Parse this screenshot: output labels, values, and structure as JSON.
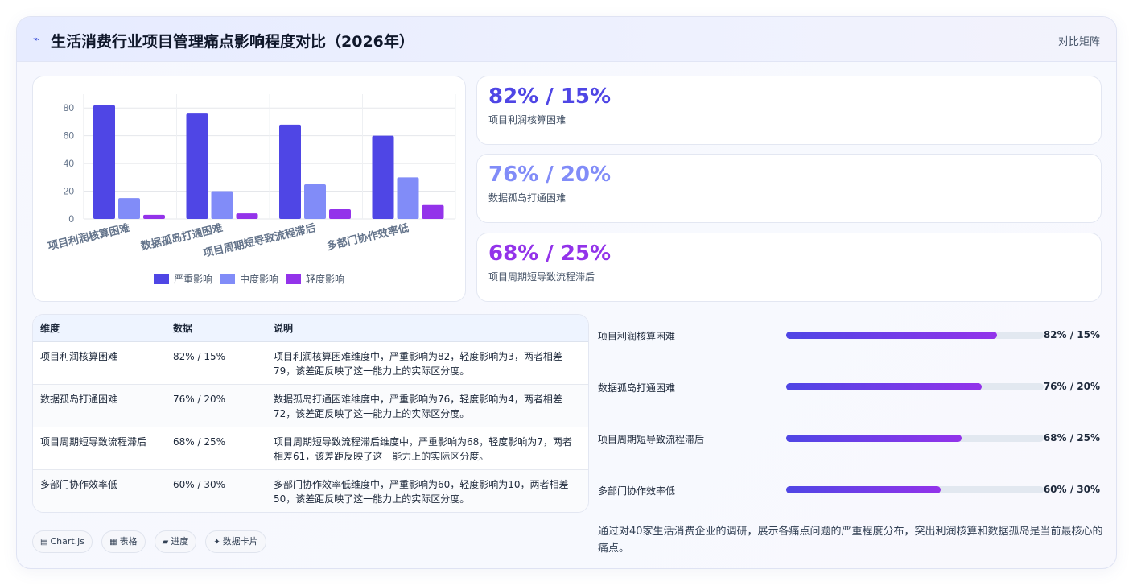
{
  "header": {
    "icon": "⌁",
    "title": "生活消费行业项目管理痛点影响程度对比（2026年）",
    "right_label": "对比矩阵"
  },
  "chart_data": {
    "type": "bar",
    "categories": [
      "项目利润核算困难",
      "数据孤岛打通困难",
      "项目周期短导致流程滞后",
      "多部门协作效率低"
    ],
    "series": [
      {
        "name": "严重影响",
        "values": [
          82,
          76,
          68,
          60
        ],
        "color": "#4f46e5"
      },
      {
        "name": "中度影响",
        "values": [
          15,
          20,
          25,
          30
        ],
        "color": "#818cf8"
      },
      {
        "name": "轻度影响",
        "values": [
          3,
          4,
          7,
          10
        ],
        "color": "#9333ea"
      }
    ],
    "yticks": [
      0,
      20,
      40,
      60,
      80
    ],
    "ylim": [
      0,
      90
    ],
    "grid": true,
    "legend_position": "bottom"
  },
  "stats": [
    {
      "value": "82% / 15%",
      "label": "项目利润核算困难",
      "color": "#4f46e5"
    },
    {
      "value": "76% / 20%",
      "label": "数据孤岛打通困难",
      "color": "#818cf8"
    },
    {
      "value": "68% / 25%",
      "label": "项目周期短导致流程滞后",
      "color": "#9333ea"
    }
  ],
  "table": {
    "headers": [
      "维度",
      "数据",
      "说明"
    ],
    "rows": [
      [
        "项目利润核算困难",
        "82% / 15%",
        "项目利润核算困难维度中，严重影响为82，轻度影响为3，两者相差79，该差距反映了这一能力上的实际区分度。"
      ],
      [
        "数据孤岛打通困难",
        "76% / 20%",
        "数据孤岛打通困难维度中，严重影响为76，轻度影响为4，两者相差72，该差距反映了这一能力上的实际区分度。"
      ],
      [
        "项目周期短导致流程滞后",
        "68% / 25%",
        "项目周期短导致流程滞后维度中，严重影响为68，轻度影响为7，两者相差61，该差距反映了这一能力上的实际区分度。"
      ],
      [
        "多部门协作效率低",
        "60% / 30%",
        "多部门协作效率低维度中，严重影响为60，轻度影响为10，两者相差50，该差距反映了这一能力上的实际区分度。"
      ]
    ]
  },
  "progress": [
    {
      "label": "项目利润核算困难",
      "value_text": "82% / 15%",
      "fill_percent": 82
    },
    {
      "label": "数据孤岛打通困难",
      "value_text": "76% / 20%",
      "fill_percent": 76
    },
    {
      "label": "项目周期短导致流程滞后",
      "value_text": "68% / 25%",
      "fill_percent": 68
    },
    {
      "label": "多部门协作效率低",
      "value_text": "60% / 30%",
      "fill_percent": 60
    }
  ],
  "summary": "通过对40家生活消费企业的调研，展示各痛点问题的严重程度分布，突出利润核算和数据孤岛是当前最核心的痛点。",
  "chips": [
    {
      "icon": "▤",
      "label": "Chart.js"
    },
    {
      "icon": "▦",
      "label": "表格"
    },
    {
      "icon": "▰",
      "label": "进度"
    },
    {
      "icon": "✦",
      "label": "数据卡片"
    }
  ]
}
